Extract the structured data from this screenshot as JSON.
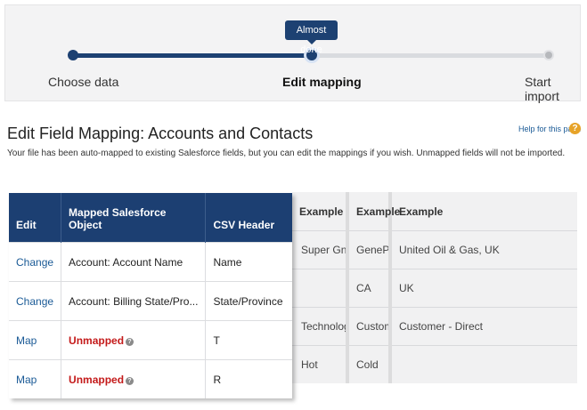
{
  "progress": {
    "bubble": "Almost done",
    "steps": [
      {
        "label": "Choose data",
        "state": "done"
      },
      {
        "label": "Edit mapping",
        "state": "current"
      },
      {
        "label": "Start import",
        "state": "todo"
      }
    ]
  },
  "page": {
    "title": "Edit Field Mapping: Accounts and Contacts",
    "help_link": "Help for this page",
    "subtitle": "Your file has been auto-mapped to existing Salesforce fields, but you can edit the mappings if you wish. Unmapped fields will not be imported."
  },
  "mapping_table": {
    "headers": [
      "Edit",
      "Mapped Salesforce Object",
      "CSV Header"
    ],
    "rows": [
      {
        "action": "Change",
        "mapped": "Account: Account Name",
        "unmapped": false,
        "csv": "Name"
      },
      {
        "action": "Change",
        "mapped": "Account: Billing State/Pro...",
        "unmapped": false,
        "csv": "State/Province"
      },
      {
        "action": "Map",
        "mapped": "Unmapped",
        "unmapped": true,
        "csv": "T"
      },
      {
        "action": "Map",
        "mapped": "Unmapped",
        "unmapped": true,
        "csv": "R"
      }
    ]
  },
  "examples_table": {
    "headers": [
      "Example",
      "Example",
      "Example"
    ],
    "rows": [
      [
        "Super Gnit",
        "GenePoint",
        "United Oil & Gas, UK"
      ],
      [
        "",
        "CA",
        "UK"
      ],
      [
        "Technology",
        "Customer -",
        "Customer - Direct"
      ],
      [
        "Hot",
        "Cold",
        ""
      ]
    ]
  },
  "colors": {
    "brand_navy": "#1c3f72",
    "link_blue": "#1a5a96",
    "unmapped_red": "#c41a1a",
    "help_orange": "#e7a328"
  },
  "icons": {
    "help": "help-question-icon",
    "info": "info-icon"
  }
}
